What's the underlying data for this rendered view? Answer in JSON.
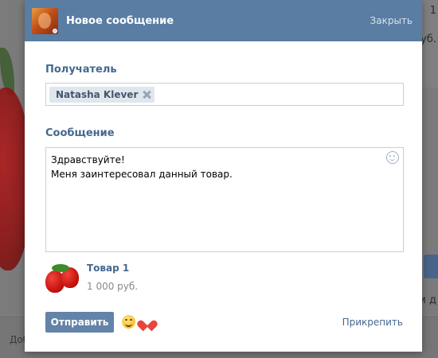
{
  "background": {
    "right_top_text_1": "1",
    "right_top_text_2": "уб.",
    "right_mid_text": "и д",
    "bottom_text": "Доб"
  },
  "modal": {
    "title": "Новое сообщение",
    "close_label": "Закрыть",
    "recipient": {
      "label": "Получатель",
      "chips": [
        {
          "name": "Natasha Klever"
        }
      ]
    },
    "message": {
      "label": "Сообщение",
      "lines": [
        "Здравствуйте!",
        "Меня заинтересовал данный товар."
      ],
      "emoji_icon": "smile-icon"
    },
    "product": {
      "name": "Товар 1",
      "price": "1 000 руб.",
      "thumb_icon": "strawberry-image"
    },
    "footer": {
      "send_label": "Отправить",
      "emoji_1": "smile-emoji",
      "emoji_2": "heart-emoji",
      "attach_label": "Прикрепить"
    }
  },
  "colors": {
    "header_bg": "#597da3",
    "link": "#45688e",
    "button_bg": "#6383a8",
    "input_border": "#c5d0db"
  }
}
